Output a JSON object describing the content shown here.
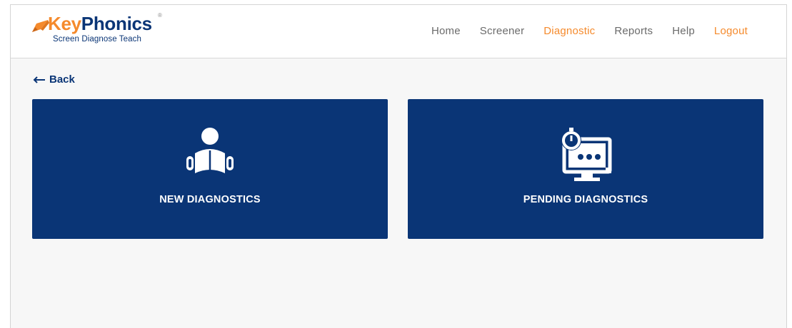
{
  "brand": {
    "name_part1": "Key",
    "name_part2": "Phonics",
    "registered_mark": "®",
    "tagline": "Screen Diagnose Teach",
    "colors": {
      "orange": "#f58a2c",
      "navy": "#0a3576"
    }
  },
  "nav": {
    "items": [
      {
        "label": "Home",
        "state": "default"
      },
      {
        "label": "Screener",
        "state": "default"
      },
      {
        "label": "Diagnostic",
        "state": "active"
      },
      {
        "label": "Reports",
        "state": "default"
      },
      {
        "label": "Help",
        "state": "default"
      },
      {
        "label": "Logout",
        "state": "logout"
      }
    ]
  },
  "back": {
    "label": "Back",
    "icon": "arrow-left-icon"
  },
  "cards": [
    {
      "label": "NEW DIAGNOSTICS",
      "icon": "reader-book-icon"
    },
    {
      "label": "PENDING DIAGNOSTICS",
      "icon": "stopwatch-monitor-icon"
    }
  ]
}
